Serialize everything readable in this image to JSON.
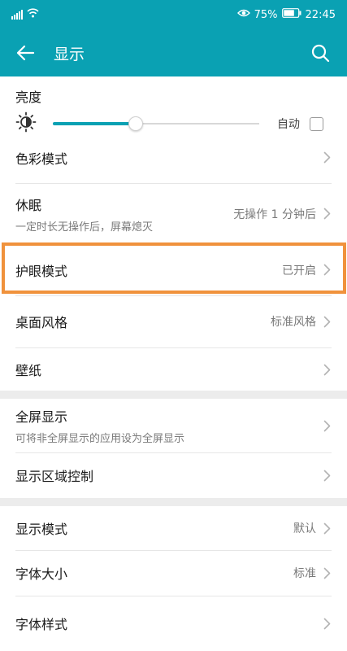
{
  "status_bar": {
    "battery": "75%",
    "time": "22:45"
  },
  "toolbar": {
    "title": "显示"
  },
  "brightness": {
    "title": "亮度",
    "level": 0.4,
    "auto_label": "自动",
    "auto_checked": false
  },
  "group1": [
    {
      "title": "色彩模式",
      "sub": "",
      "value": ""
    },
    {
      "title": "休眠",
      "sub": "一定时长无操作后，屏幕熄灭",
      "value": "无操作 1 分钟后"
    },
    {
      "title": "护眼模式",
      "sub": "",
      "value": "已开启"
    },
    {
      "title": "桌面风格",
      "sub": "",
      "value": "标准风格"
    },
    {
      "title": "壁纸",
      "sub": "",
      "value": ""
    }
  ],
  "group2": [
    {
      "title": "全屏显示",
      "sub": "可将非全屏显示的应用设为全屏显示",
      "value": ""
    },
    {
      "title": "显示区域控制",
      "sub": "",
      "value": ""
    }
  ],
  "group3": [
    {
      "title": "显示模式",
      "sub": "",
      "value": "默认"
    },
    {
      "title": "字体大小",
      "sub": "",
      "value": "标准"
    },
    {
      "title": "字体样式",
      "sub": "",
      "value": ""
    }
  ],
  "colors": {
    "accent": "#0aa1b3",
    "highlight": "#f0923c"
  }
}
